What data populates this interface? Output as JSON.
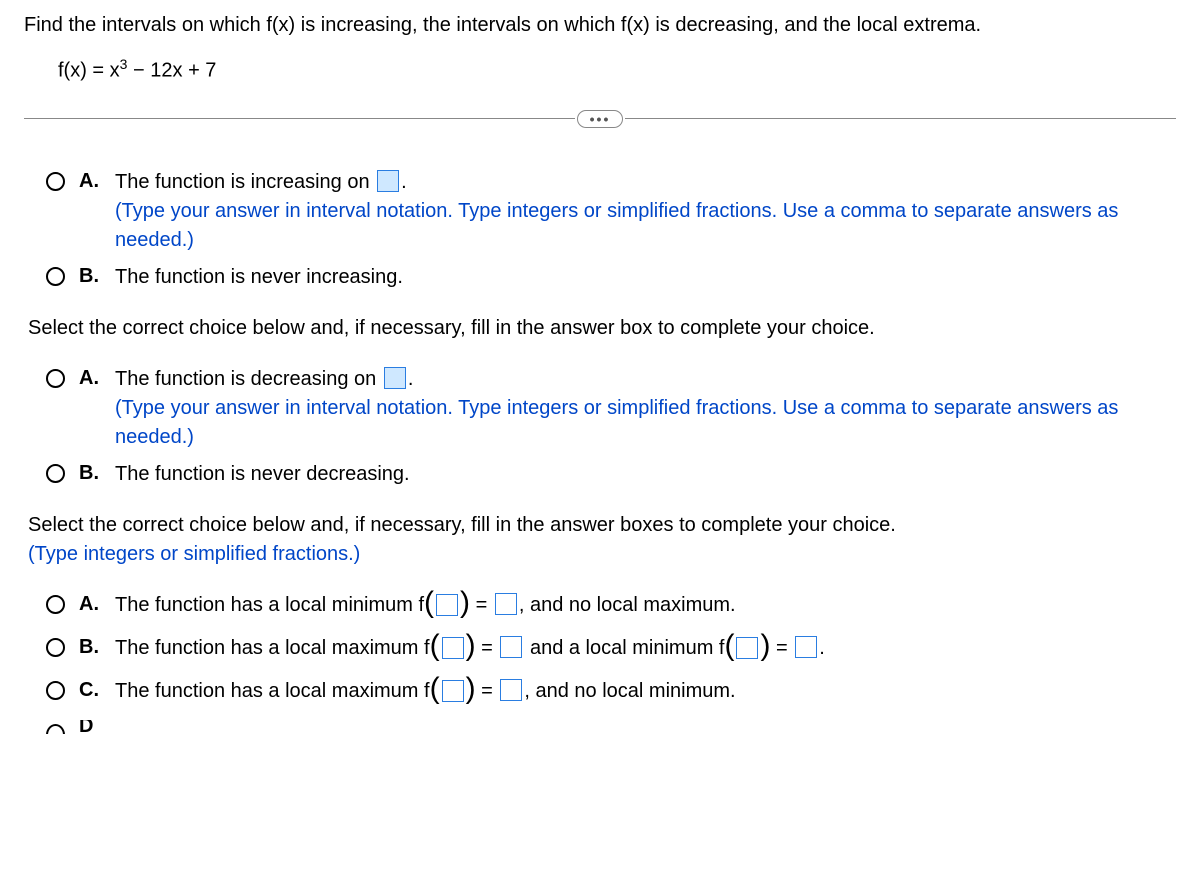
{
  "intro": "Find the intervals on which f(x) is increasing, the intervals on which f(x) is decreasing, and the local extrema.",
  "formula_prefix": "f(x) = x",
  "formula_exp": "3",
  "formula_suffix": " − 12x + 7",
  "ellipsis": "•••",
  "group1": {
    "A_pre": "The function is increasing on ",
    "A_post": ".",
    "A_hint": "(Type your answer in interval notation. Type integers or simplified fractions. Use a comma to separate answers as needed.)",
    "B": "The function is never increasing."
  },
  "prompt2": "Select the correct choice below and, if necessary, fill in the answer box to complete your choice.",
  "group2": {
    "A_pre": "The function is decreasing on ",
    "A_post": ".",
    "A_hint": "(Type your answer in interval notation. Type integers or simplified fractions. Use a comma to separate answers as needed.)",
    "B": "The function is never decreasing."
  },
  "prompt3_line1": "Select the correct choice below and, if necessary, fill in the answer boxes to complete your choice.",
  "prompt3_line2": "(Type integers or simplified fractions.)",
  "group3": {
    "A_pre": "The function has a local minimum f",
    "A_mid": " = ",
    "A_post": ", and no local maximum.",
    "B_pre": "The function has a local maximum f",
    "B_mid1": " = ",
    "B_mid2": " and a local minimum f",
    "B_mid3": " = ",
    "B_post": ".",
    "C_pre": "The function has a local maximum f",
    "C_mid": " = ",
    "C_post": ", and no local minimum."
  },
  "letters": {
    "A": "A.",
    "B": "B.",
    "C": "C.",
    "D": "D"
  }
}
